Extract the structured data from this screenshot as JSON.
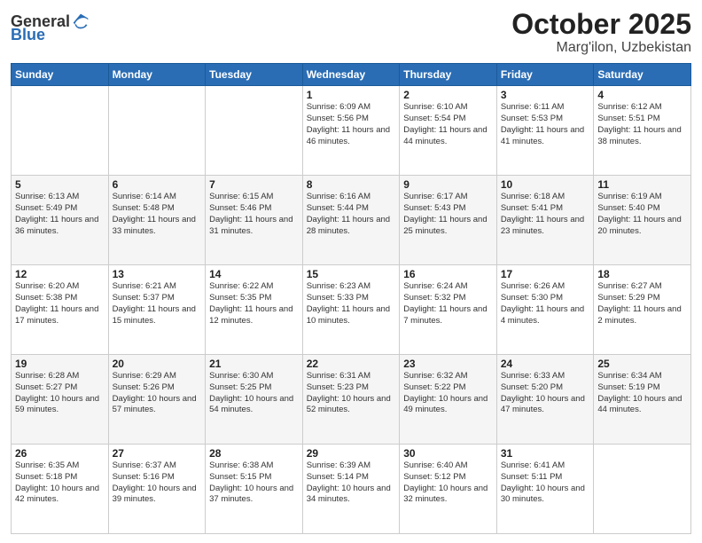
{
  "header": {
    "logo_general": "General",
    "logo_blue": "Blue",
    "month": "October 2025",
    "location": "Marg'ilon, Uzbekistan"
  },
  "weekdays": [
    "Sunday",
    "Monday",
    "Tuesday",
    "Wednesday",
    "Thursday",
    "Friday",
    "Saturday"
  ],
  "weeks": [
    [
      {
        "day": "",
        "info": ""
      },
      {
        "day": "",
        "info": ""
      },
      {
        "day": "",
        "info": ""
      },
      {
        "day": "1",
        "info": "Sunrise: 6:09 AM\nSunset: 5:56 PM\nDaylight: 11 hours and 46 minutes."
      },
      {
        "day": "2",
        "info": "Sunrise: 6:10 AM\nSunset: 5:54 PM\nDaylight: 11 hours and 44 minutes."
      },
      {
        "day": "3",
        "info": "Sunrise: 6:11 AM\nSunset: 5:53 PM\nDaylight: 11 hours and 41 minutes."
      },
      {
        "day": "4",
        "info": "Sunrise: 6:12 AM\nSunset: 5:51 PM\nDaylight: 11 hours and 38 minutes."
      }
    ],
    [
      {
        "day": "5",
        "info": "Sunrise: 6:13 AM\nSunset: 5:49 PM\nDaylight: 11 hours and 36 minutes."
      },
      {
        "day": "6",
        "info": "Sunrise: 6:14 AM\nSunset: 5:48 PM\nDaylight: 11 hours and 33 minutes."
      },
      {
        "day": "7",
        "info": "Sunrise: 6:15 AM\nSunset: 5:46 PM\nDaylight: 11 hours and 31 minutes."
      },
      {
        "day": "8",
        "info": "Sunrise: 6:16 AM\nSunset: 5:44 PM\nDaylight: 11 hours and 28 minutes."
      },
      {
        "day": "9",
        "info": "Sunrise: 6:17 AM\nSunset: 5:43 PM\nDaylight: 11 hours and 25 minutes."
      },
      {
        "day": "10",
        "info": "Sunrise: 6:18 AM\nSunset: 5:41 PM\nDaylight: 11 hours and 23 minutes."
      },
      {
        "day": "11",
        "info": "Sunrise: 6:19 AM\nSunset: 5:40 PM\nDaylight: 11 hours and 20 minutes."
      }
    ],
    [
      {
        "day": "12",
        "info": "Sunrise: 6:20 AM\nSunset: 5:38 PM\nDaylight: 11 hours and 17 minutes."
      },
      {
        "day": "13",
        "info": "Sunrise: 6:21 AM\nSunset: 5:37 PM\nDaylight: 11 hours and 15 minutes."
      },
      {
        "day": "14",
        "info": "Sunrise: 6:22 AM\nSunset: 5:35 PM\nDaylight: 11 hours and 12 minutes."
      },
      {
        "day": "15",
        "info": "Sunrise: 6:23 AM\nSunset: 5:33 PM\nDaylight: 11 hours and 10 minutes."
      },
      {
        "day": "16",
        "info": "Sunrise: 6:24 AM\nSunset: 5:32 PM\nDaylight: 11 hours and 7 minutes."
      },
      {
        "day": "17",
        "info": "Sunrise: 6:26 AM\nSunset: 5:30 PM\nDaylight: 11 hours and 4 minutes."
      },
      {
        "day": "18",
        "info": "Sunrise: 6:27 AM\nSunset: 5:29 PM\nDaylight: 11 hours and 2 minutes."
      }
    ],
    [
      {
        "day": "19",
        "info": "Sunrise: 6:28 AM\nSunset: 5:27 PM\nDaylight: 10 hours and 59 minutes."
      },
      {
        "day": "20",
        "info": "Sunrise: 6:29 AM\nSunset: 5:26 PM\nDaylight: 10 hours and 57 minutes."
      },
      {
        "day": "21",
        "info": "Sunrise: 6:30 AM\nSunset: 5:25 PM\nDaylight: 10 hours and 54 minutes."
      },
      {
        "day": "22",
        "info": "Sunrise: 6:31 AM\nSunset: 5:23 PM\nDaylight: 10 hours and 52 minutes."
      },
      {
        "day": "23",
        "info": "Sunrise: 6:32 AM\nSunset: 5:22 PM\nDaylight: 10 hours and 49 minutes."
      },
      {
        "day": "24",
        "info": "Sunrise: 6:33 AM\nSunset: 5:20 PM\nDaylight: 10 hours and 47 minutes."
      },
      {
        "day": "25",
        "info": "Sunrise: 6:34 AM\nSunset: 5:19 PM\nDaylight: 10 hours and 44 minutes."
      }
    ],
    [
      {
        "day": "26",
        "info": "Sunrise: 6:35 AM\nSunset: 5:18 PM\nDaylight: 10 hours and 42 minutes."
      },
      {
        "day": "27",
        "info": "Sunrise: 6:37 AM\nSunset: 5:16 PM\nDaylight: 10 hours and 39 minutes."
      },
      {
        "day": "28",
        "info": "Sunrise: 6:38 AM\nSunset: 5:15 PM\nDaylight: 10 hours and 37 minutes."
      },
      {
        "day": "29",
        "info": "Sunrise: 6:39 AM\nSunset: 5:14 PM\nDaylight: 10 hours and 34 minutes."
      },
      {
        "day": "30",
        "info": "Sunrise: 6:40 AM\nSunset: 5:12 PM\nDaylight: 10 hours and 32 minutes."
      },
      {
        "day": "31",
        "info": "Sunrise: 6:41 AM\nSunset: 5:11 PM\nDaylight: 10 hours and 30 minutes."
      },
      {
        "day": "",
        "info": ""
      }
    ]
  ]
}
